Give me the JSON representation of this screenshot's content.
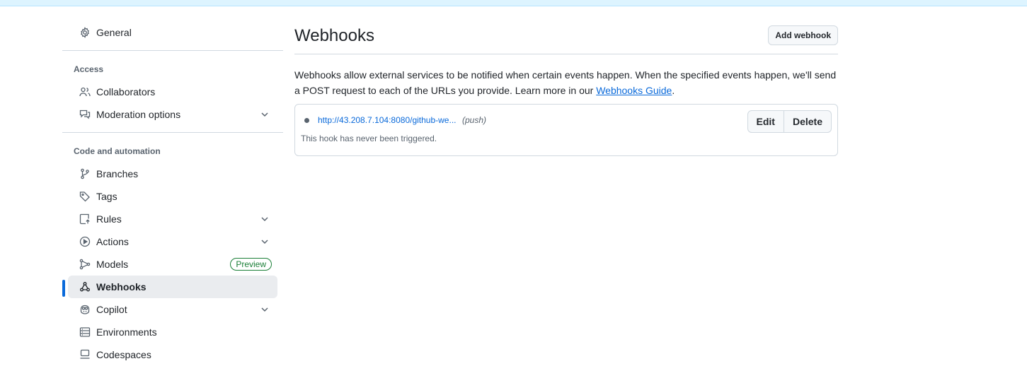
{
  "sidebar": {
    "general": "General",
    "access_heading": "Access",
    "collaborators": "Collaborators",
    "moderation": "Moderation options",
    "code_heading": "Code and automation",
    "branches": "Branches",
    "tags": "Tags",
    "rules": "Rules",
    "actions": "Actions",
    "models": "Models",
    "models_badge": "Preview",
    "webhooks": "Webhooks",
    "copilot": "Copilot",
    "environments": "Environments",
    "codespaces": "Codespaces"
  },
  "main": {
    "title": "Webhooks",
    "add_button": "Add webhook",
    "description": "Webhooks allow external services to be notified when certain events happen. When the specified events happen, we'll send a POST request to each of the URLs you provide. Learn more in our ",
    "guide_link": "Webhooks Guide",
    "description_end": ".",
    "hook": {
      "url": "http://43.208.7.104:8080/github-we...",
      "event": "(push)",
      "status": "This hook has never been triggered.",
      "edit": "Edit",
      "delete": "Delete"
    }
  },
  "colors": {
    "accent": "#0969da",
    "badge_green": "#1a7f37",
    "banner": "#ddf4ff"
  }
}
